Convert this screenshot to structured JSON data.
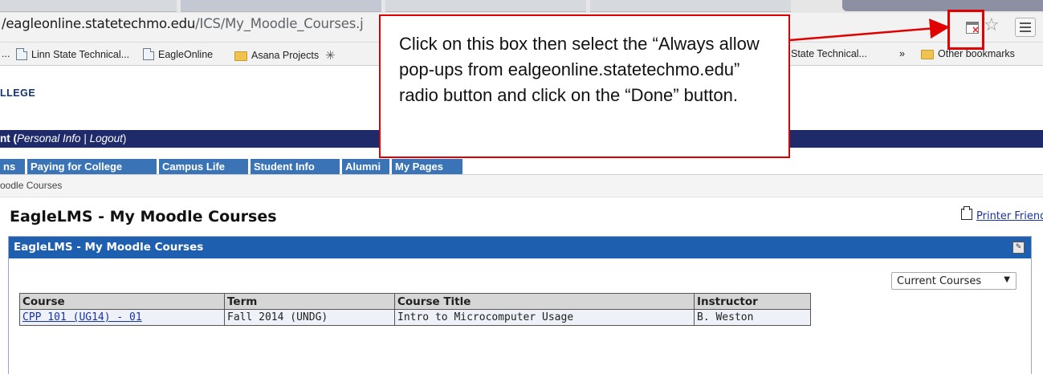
{
  "browser": {
    "url_host": "/eagleonline.statetechmo.edu",
    "url_path": "/ICS/My_Moodle_Courses.j",
    "icons": [
      "popup-blocked-icon",
      "star-icon",
      "menu-icon"
    ]
  },
  "bookmarks": {
    "leading": "...",
    "items": [
      "Linn State Technical...",
      "EagleOnline",
      "Asana Projects"
    ],
    "right_item": "State Technical...",
    "overflow": "»",
    "other": "Other bookmarks"
  },
  "site": {
    "logo": "LLEGE",
    "user_prefix": "nt (",
    "personal_info": "Personal Info",
    "separator": "|",
    "logout": "Logout",
    "user_suffix": ")",
    "tabs": [
      "ns",
      "Paying for College",
      "Campus Life",
      "Student Info",
      "Alumni",
      "My Pages"
    ],
    "breadcrumb": "oodle Courses"
  },
  "page": {
    "title": "EagleLMS - My Moodle Courses",
    "printer": "Printer Friendly",
    "panel_title": "EagleLMS - My Moodle Courses",
    "select_value": "Current Courses"
  },
  "table": {
    "headers": [
      "Course",
      "Term",
      "Course Title",
      "Instructor"
    ],
    "rows": [
      [
        "CPP 101 (UG14) - 01",
        "Fall 2014 (UNDG)",
        "Intro to Microcomputer Usage",
        "B. Weston"
      ]
    ]
  },
  "annotation": {
    "text": "Click on this box then select the “Always allow pop-ups from ealgeonline.statetechmo.edu” radio button and click on the “Done” button.",
    "color": "#e00000"
  }
}
